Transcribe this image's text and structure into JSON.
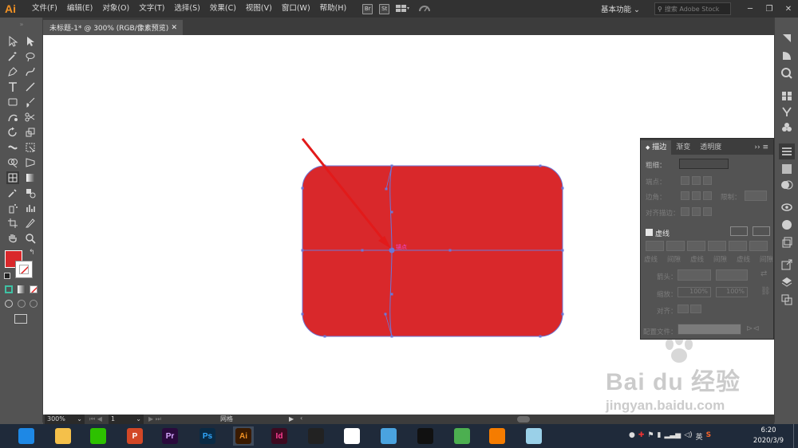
{
  "app": {
    "logo": "Ai",
    "accent": "#f29224"
  },
  "menubar": {
    "items": [
      "文件(F)",
      "编辑(E)",
      "对象(O)",
      "文字(T)",
      "选择(S)",
      "效果(C)",
      "视图(V)",
      "窗口(W)",
      "帮助(H)"
    ],
    "badges": [
      "Br",
      "St"
    ],
    "workspace": "基本功能",
    "search_placeholder": "搜索 Adobe Stock",
    "window_buttons": [
      "─",
      "❐",
      "✕"
    ]
  },
  "document": {
    "tab_title": "未标题-1* @ 300% (RGB/像素预览)",
    "tab_close": "✕"
  },
  "canvas": {
    "shape_fill": "#d9282b",
    "path_color": "#6b77d8",
    "anchor_label": "锚点",
    "anchor_label_color": "#e64bd0",
    "arrow_color": "#e21a1a"
  },
  "tools": {
    "fill_color": "#d9282b",
    "stroke_color": "#ffffff",
    "icons": [
      "selection-icon",
      "direct-selection-icon",
      "magic-wand-icon",
      "lasso-icon",
      "pen-icon",
      "curvature-icon",
      "type-icon",
      "line-icon",
      "rectangle-icon",
      "paintbrush-icon",
      "shaper-icon",
      "scissors-icon",
      "rotate-icon",
      "scale-icon",
      "width-icon",
      "free-transform-icon",
      "shape-builder-icon",
      "perspective-icon",
      "mesh-icon",
      "gradient-icon",
      "eyedropper-icon",
      "blend-icon",
      "symbol-sprayer-icon",
      "graph-icon",
      "artboard-icon",
      "slice-icon",
      "hand-icon",
      "zoom-icon"
    ]
  },
  "stroke_panel": {
    "tabs": [
      "描边",
      "渐变",
      "透明度"
    ],
    "weight_label": "粗细：",
    "cap_label": "端点：",
    "corner_label": "边角：",
    "limit_label": "限制：",
    "align_label": "对齐描边：",
    "dashed_label": "虚线",
    "dash_labels": [
      "虚线",
      "间隙",
      "虚线",
      "间隙",
      "虚线",
      "间隙"
    ],
    "arrow_label": "箭头：",
    "scale_label": "缩放：",
    "scale_values": [
      "100%",
      "100%"
    ],
    "align2_label": "对齐：",
    "profile_label": "配置文件："
  },
  "statusbar": {
    "zoom": "300%",
    "page": "1",
    "mode": "网格"
  },
  "taskbar": {
    "apps": [
      {
        "name": "ie-icon",
        "label": "",
        "color": "#1e88e5"
      },
      {
        "name": "explorer-icon",
        "label": "",
        "color": "#f4c04a"
      },
      {
        "name": "wechat-icon",
        "label": "",
        "color": "#2dc100"
      },
      {
        "name": "powerpoint-icon",
        "label": "P",
        "color": "#d24726"
      },
      {
        "name": "premiere-icon",
        "label": "Pr",
        "color": "#2a0a3c"
      },
      {
        "name": "photoshop-icon",
        "label": "Ps",
        "color": "#0a2a44"
      },
      {
        "name": "illustrator-icon",
        "label": "Ai",
        "color": "#3a1a00"
      },
      {
        "name": "indesign-icon",
        "label": "Id",
        "color": "#3d0a20"
      },
      {
        "name": "video-editor-icon",
        "label": "",
        "color": "#222222"
      },
      {
        "name": "color-app-icon",
        "label": "",
        "color": "#ffffff"
      },
      {
        "name": "bird-app-icon",
        "label": "",
        "color": "#4aa3df"
      },
      {
        "name": "qq-icon",
        "label": "",
        "color": "#111111"
      },
      {
        "name": "chrome-icon",
        "label": "",
        "color": "#4caf50"
      },
      {
        "name": "fox-app-icon",
        "label": "",
        "color": "#f57c00"
      },
      {
        "name": "book-app-icon",
        "label": "",
        "color": "#9ad0e8"
      }
    ],
    "time": "6:20",
    "date": "2020/3/9",
    "ime": "英"
  },
  "watermark": {
    "logo": "Bai du 经验",
    "url": "jingyan.baidu.com"
  }
}
